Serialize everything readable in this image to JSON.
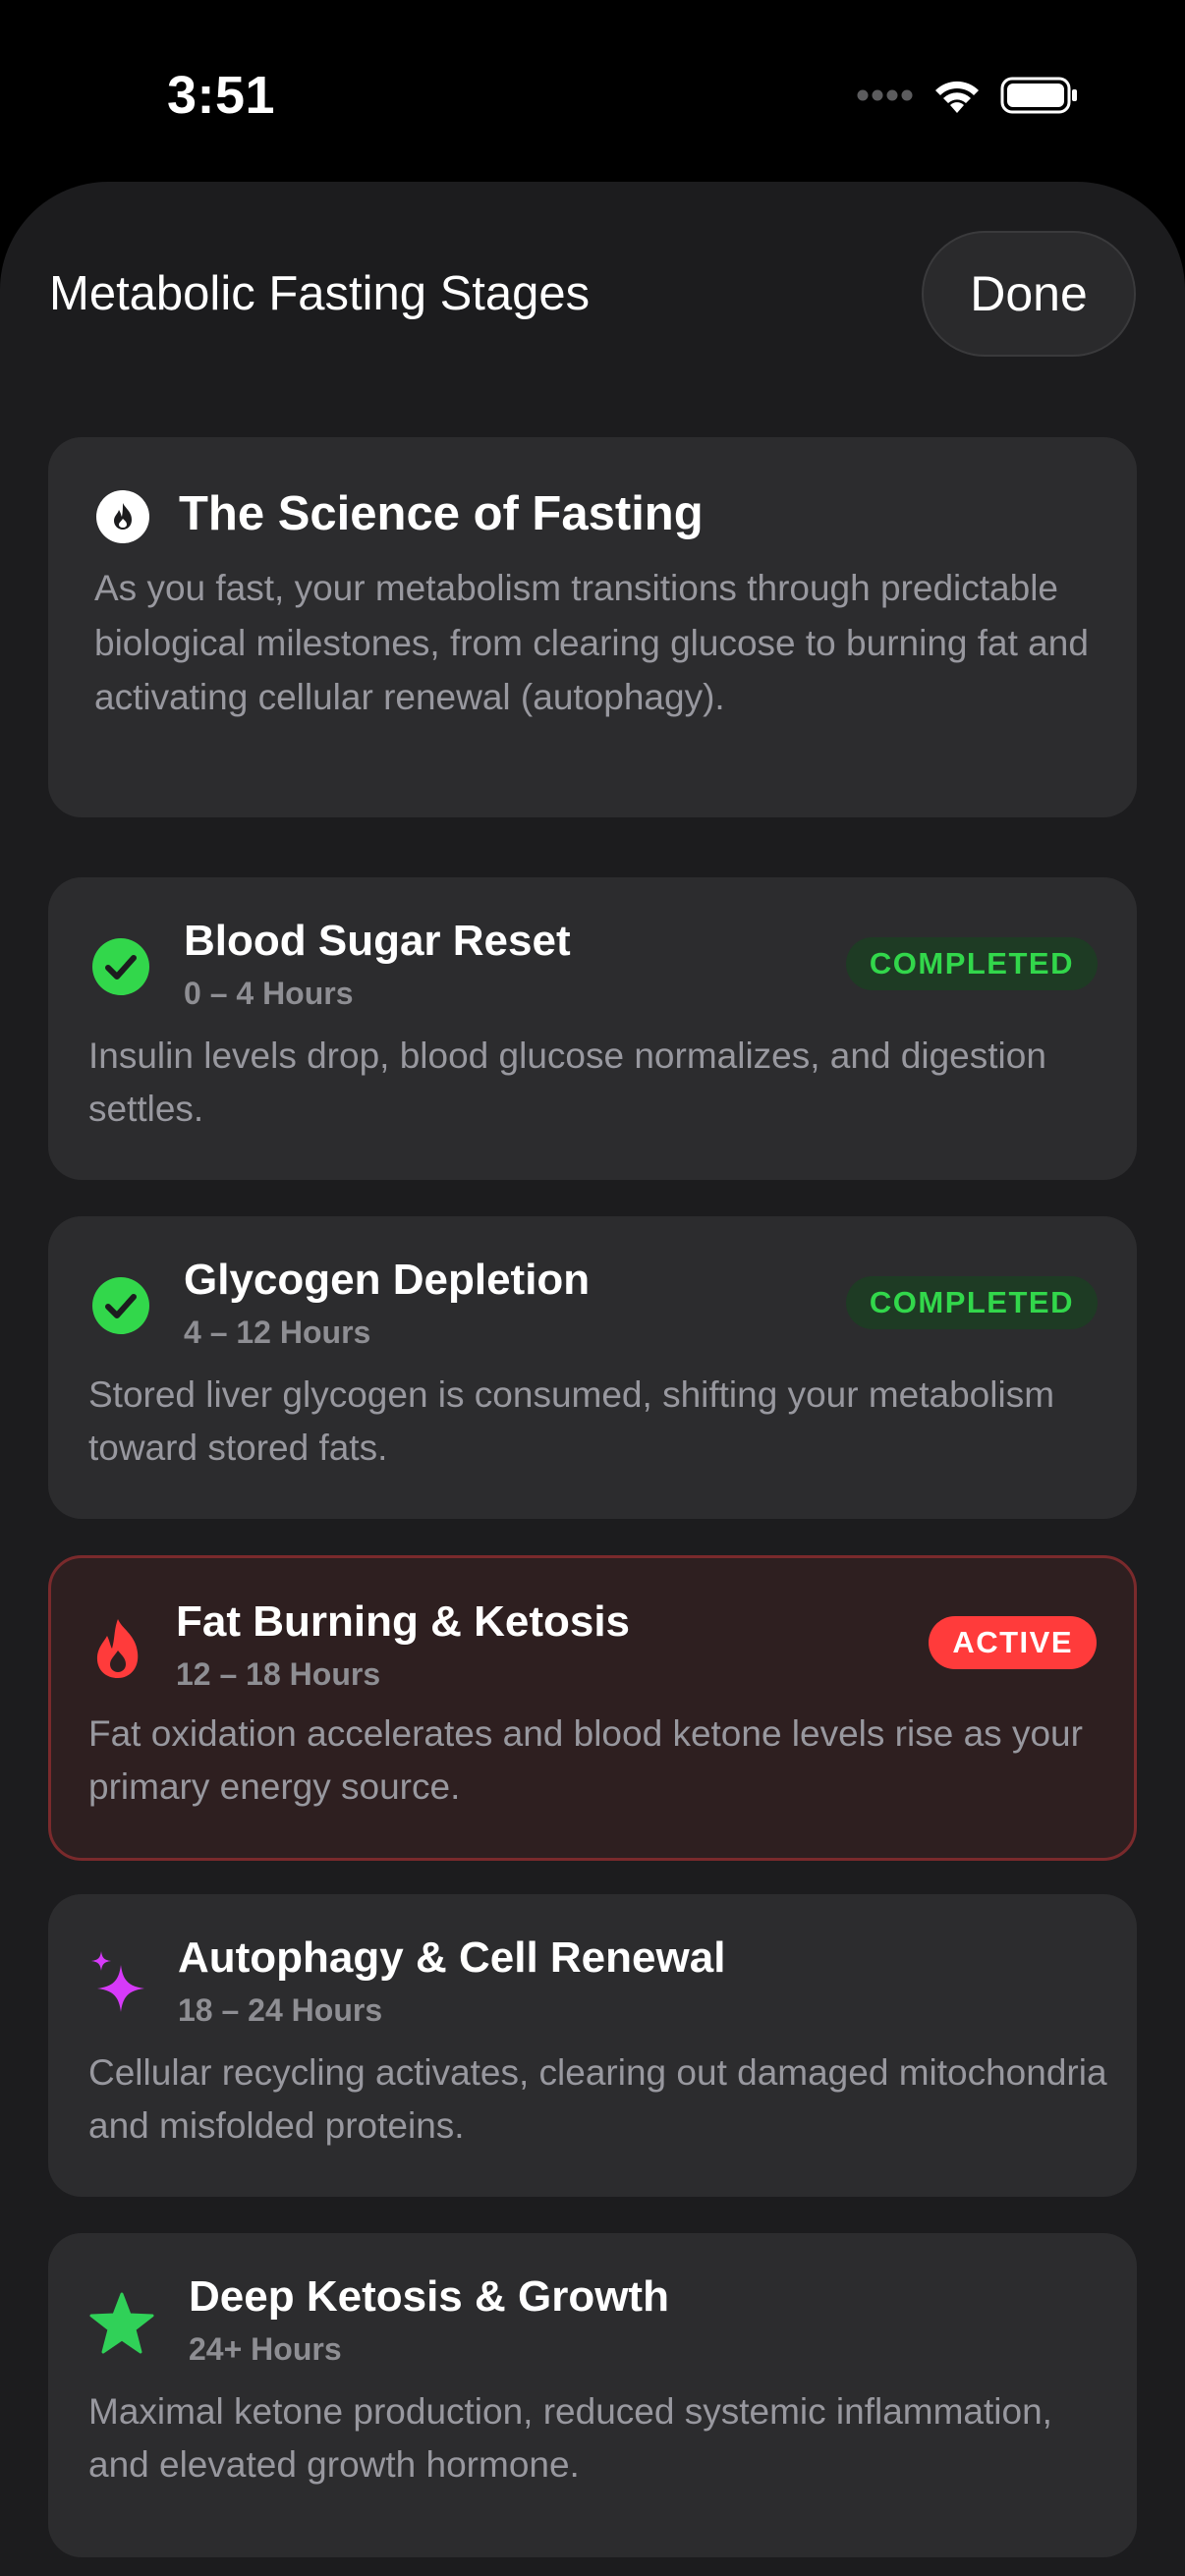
{
  "status_bar": {
    "time": "3:51"
  },
  "sheet": {
    "title": "Metabolic Fasting Stages",
    "done_label": "Done"
  },
  "intro": {
    "icon": "flame-circle-icon",
    "title": "The Science of Fasting",
    "body": "As you fast, your metabolism transitions through predictable biological milestones, from clearing glucose to burning fat and activating cellular renewal (autophagy)."
  },
  "stages": [
    {
      "icon": "checkmark-circle-icon",
      "title": "Blood Sugar Reset",
      "hours": "0 – 4 Hours",
      "description": "Insulin levels drop, blood glucose normalizes, and digestion settles.",
      "badge": "COMPLETED"
    },
    {
      "icon": "checkmark-circle-icon",
      "title": "Glycogen Depletion",
      "hours": "4 – 12 Hours",
      "description": "Stored liver glycogen is consumed, shifting your metabolism toward stored fats.",
      "badge": "COMPLETED"
    },
    {
      "icon": "flame-icon",
      "title": "Fat Burning & Ketosis",
      "hours": "12 – 18 Hours",
      "description": "Fat oxidation accelerates and blood ketone levels rise as your primary energy source.",
      "badge": "ACTIVE"
    },
    {
      "icon": "sparkles-icon",
      "title": "Autophagy & Cell Renewal",
      "hours": "18 – 24 Hours",
      "description": "Cellular recycling activates, clearing out damaged mitochondria and misfolded proteins."
    },
    {
      "icon": "star-icon",
      "title": "Deep Ketosis & Growth",
      "hours": "24+ Hours",
      "description": "Maximal ketone production, reduced systemic inflammation, and elevated growth hormone."
    }
  ],
  "colors": {
    "completed_green": "#32d74b",
    "active_red": "#ff3b3b",
    "autophagy_magenta": "#d63af9",
    "star_green": "#30d158"
  }
}
